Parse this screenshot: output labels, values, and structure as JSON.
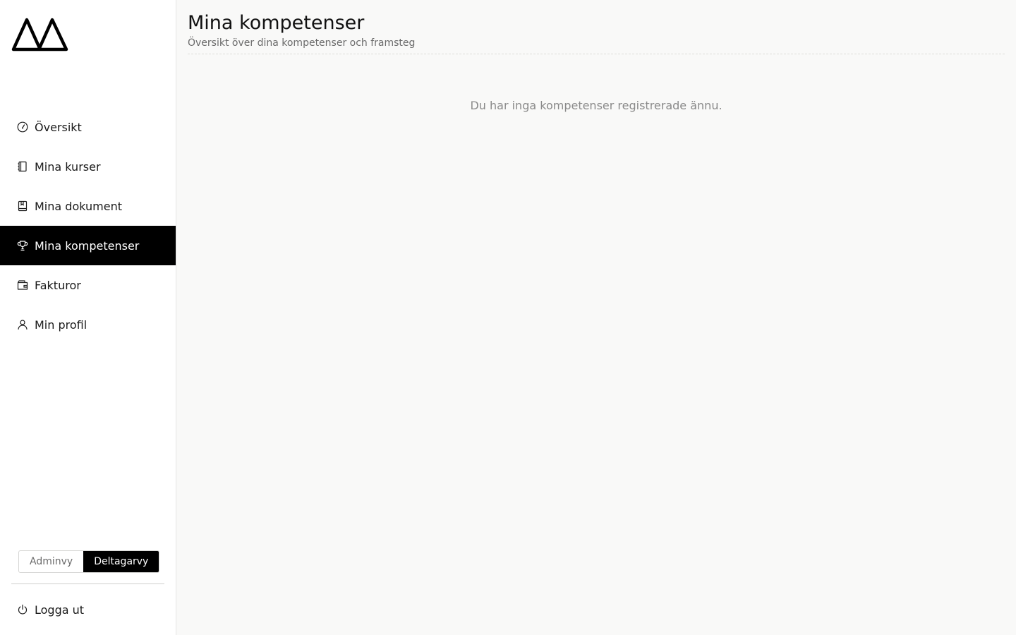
{
  "sidebar": {
    "logo_icon": "mountain-logo",
    "nav": [
      {
        "label": "Översikt",
        "icon": "gauge-icon"
      },
      {
        "label": "Mina kurser",
        "icon": "notebook-icon"
      },
      {
        "label": "Mina dokument",
        "icon": "book-icon"
      },
      {
        "label": "Mina kompetenser",
        "icon": "trophy-icon",
        "active": true
      },
      {
        "label": "Fakturor",
        "icon": "wallet-icon"
      },
      {
        "label": "Min profil",
        "icon": "user-icon"
      }
    ],
    "view_toggle": {
      "admin_label": "Adminvy",
      "participant_label": "Deltagarvy",
      "selected": "Deltagarvy"
    },
    "logout_label": "Logga ut"
  },
  "main": {
    "title": "Mina kompetenser",
    "subtitle": "Översikt över dina kompetenser och framsteg",
    "empty_message": "Du har inga kompetenser registrerade ännu."
  },
  "colors": {
    "active_bg": "#000000",
    "page_bg": "#f9f9f8",
    "sidebar_bg": "#ffffff"
  }
}
